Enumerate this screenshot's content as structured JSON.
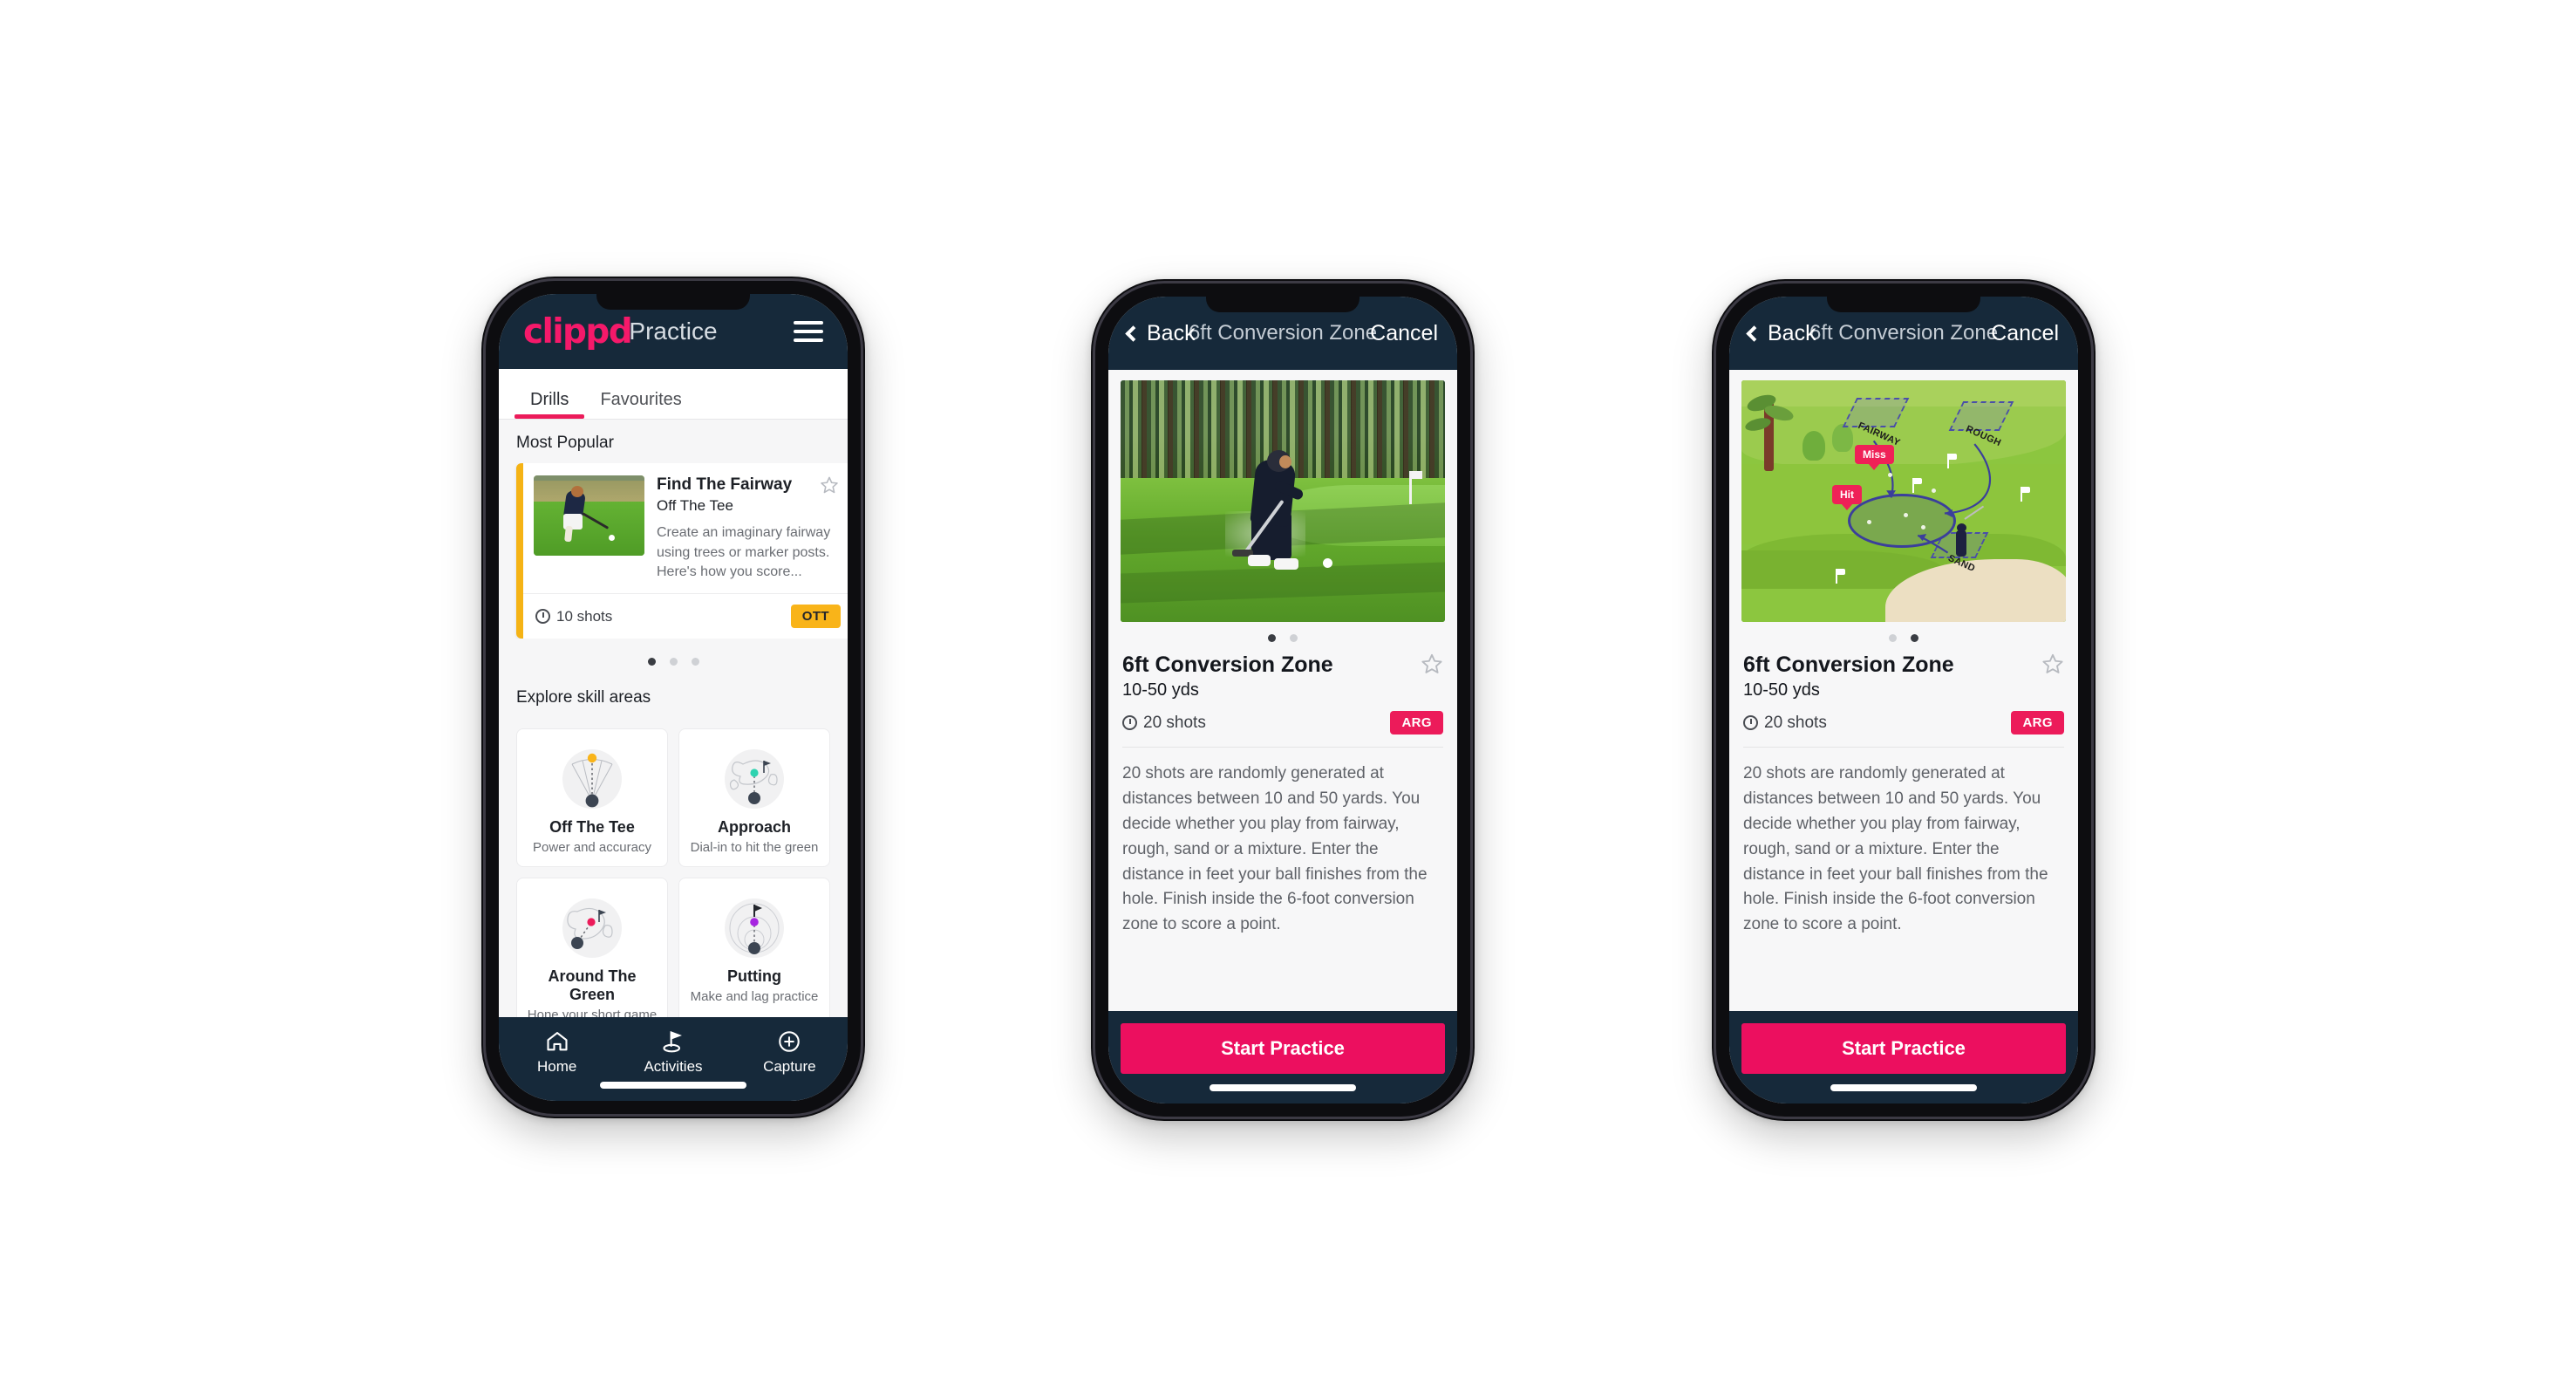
{
  "phone1": {
    "appbar": {
      "logo": "clippd",
      "title": "Practice",
      "menu_icon": "hamburger-icon"
    },
    "tabs": [
      {
        "label": "Drills",
        "active": true
      },
      {
        "label": "Favourites",
        "active": false
      }
    ],
    "most_popular": {
      "section_title": "Most Popular",
      "card": {
        "title": "Find The Fairway",
        "subtitle": "Off The Tee",
        "description": "Create an imaginary fairway using trees or marker posts. Here's how you score...",
        "shots": "10 shots",
        "chip": "OTT",
        "chip_color": "#f9b419",
        "accent_color": "#f5b315",
        "favourite_icon": "star-outline-icon"
      },
      "dots": 3,
      "active_dot": 1
    },
    "skill_areas": {
      "section_title": "Explore skill areas",
      "items": [
        {
          "name": "Off The Tee",
          "desc": "Power and accuracy",
          "icon": "fan-tee-icon",
          "accent": "#f9b419"
        },
        {
          "name": "Approach",
          "desc": "Dial-in to hit the green",
          "icon": "green-approach-icon",
          "accent": "#2ed3b0"
        },
        {
          "name": "Around The Green",
          "desc": "Hone your short game",
          "icon": "chip-green-icon",
          "accent": "#ec1b5a"
        },
        {
          "name": "Putting",
          "desc": "Make and lag practice",
          "icon": "putting-rings-icon",
          "accent": "#a625e0"
        }
      ]
    },
    "tabbar": [
      {
        "label": "Home",
        "icon": "home-icon",
        "active": false
      },
      {
        "label": "Activities",
        "icon": "golf-flag-icon",
        "active": true
      },
      {
        "label": "Capture",
        "icon": "plus-circle-icon",
        "active": false
      }
    ]
  },
  "phone2": {
    "navbar": {
      "back": "Back",
      "title": "6ft Conversion Zone",
      "cancel": "Cancel",
      "back_icon": "chevron-left-icon"
    },
    "hero": {
      "kind": "photo-golfer-chipping"
    },
    "dots": 2,
    "active_dot": 1,
    "detail": {
      "title": "6ft Conversion Zone",
      "range": "10-50 yds",
      "shots": "20 shots",
      "chip": "ARG",
      "chip_color": "#ec1b5a",
      "favourite_icon": "star-outline-icon",
      "body": "20 shots are randomly generated at distances between 10 and 50 yards. You decide whether you play from fairway, rough, sand or a mixture. Enter the distance in feet your ball finishes from the hole. Finish inside the 6-foot conversion zone to score a point."
    },
    "cta": "Start Practice",
    "cta_color": "#ec0f5f"
  },
  "phone3": {
    "navbar": {
      "back": "Back",
      "title": "6ft Conversion Zone",
      "cancel": "Cancel",
      "back_icon": "chevron-left-icon"
    },
    "hero": {
      "kind": "course-diagram",
      "labels": [
        "FAIRWAY",
        "ROUGH",
        "SAND"
      ],
      "tags": [
        "Miss",
        "Hit"
      ]
    },
    "dots": 2,
    "active_dot": 2,
    "detail": {
      "title": "6ft Conversion Zone",
      "range": "10-50 yds",
      "shots": "20 shots",
      "chip": "ARG",
      "chip_color": "#ec1b5a",
      "favourite_icon": "star-outline-icon",
      "body": "20 shots are randomly generated at distances between 10 and 50 yards. You decide whether you play from fairway, rough, sand or a mixture. Enter the distance in feet your ball finishes from the hole. Finish inside the 6-foot conversion zone to score a point."
    },
    "cta": "Start Practice",
    "cta_color": "#ec0f5f"
  },
  "theme": {
    "brand_pink": "#ec1b5a",
    "dark_navy": "#16293a",
    "page_bg": "#ffffff",
    "screen_bg": "#f7f7f8"
  }
}
